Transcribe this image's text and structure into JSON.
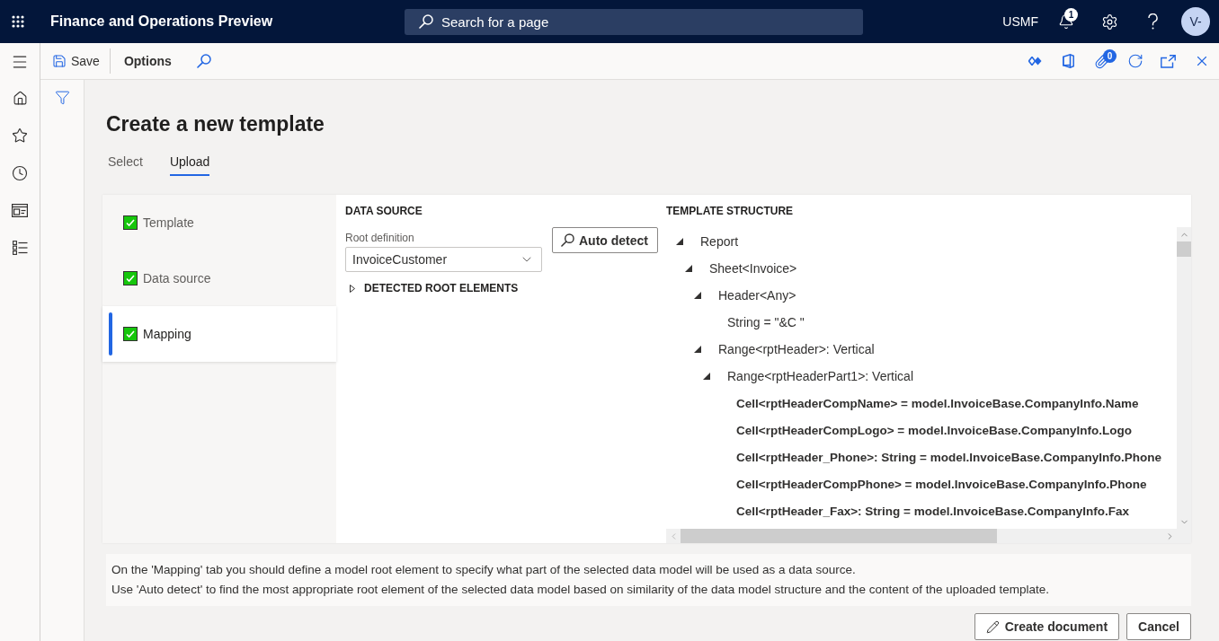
{
  "app_bar": {
    "title": "Finance and Operations Preview",
    "search": {
      "placeholder": "Search for a page"
    },
    "company": "USMF",
    "notifications": {
      "count": "1"
    },
    "avatar": {
      "initials": "V-"
    }
  },
  "action_bar": {
    "save": "Save",
    "options": "Options",
    "attachments": {
      "count": "0"
    }
  },
  "page": {
    "title": "Create a new template",
    "tabs": [
      {
        "label": "Select",
        "selected": false
      },
      {
        "label": "Upload",
        "selected": true
      }
    ]
  },
  "steps": [
    {
      "label": "Template",
      "checked": true,
      "selected": false
    },
    {
      "label": "Data source",
      "checked": true,
      "selected": false
    },
    {
      "label": "Mapping",
      "checked": true,
      "selected": true
    }
  ],
  "data_source": {
    "heading": "DATA SOURCE",
    "root_definition": {
      "label": "Root definition",
      "value": "InvoiceCustomer"
    },
    "auto_detect": "Auto detect",
    "detected_root_elements": {
      "label": "DETECTED ROOT ELEMENTS",
      "expanded": false
    }
  },
  "template_structure": {
    "heading": "TEMPLATE STRUCTURE",
    "tree": [
      {
        "label": "Report",
        "expanded": true,
        "bound": false,
        "children": [
          {
            "label": "Sheet<Invoice>",
            "expanded": true,
            "bound": false,
            "children": [
              {
                "label": "Header<Any>",
                "expanded": true,
                "bound": false,
                "children": [
                  {
                    "label": "String = \"&C \"",
                    "bound": false
                  }
                ]
              },
              {
                "label": "Range<rptHeader>: Vertical",
                "expanded": true,
                "bound": false,
                "children": [
                  {
                    "label": "Range<rptHeaderPart1>: Vertical",
                    "expanded": true,
                    "bound": false,
                    "children": [
                      {
                        "label": "Cell<rptHeaderCompName> = model.InvoiceBase.CompanyInfo.Name",
                        "bound": true
                      },
                      {
                        "label": "Cell<rptHeaderCompLogo> = model.InvoiceBase.CompanyInfo.Logo",
                        "bound": true
                      },
                      {
                        "label": "Cell<rptHeader_Phone>: String = model.InvoiceBase.CompanyInfo.Phone",
                        "bound": true
                      },
                      {
                        "label": "Cell<rptHeaderCompPhone> = model.InvoiceBase.CompanyInfo.Phone",
                        "bound": true
                      },
                      {
                        "label": "Cell<rptHeader_Fax>: String = model.InvoiceBase.CompanyInfo.Fax",
                        "bound": true
                      }
                    ]
                  }
                ]
              }
            ]
          }
        ]
      }
    ]
  },
  "info": [
    "On the 'Mapping' tab you should define a model root element to specify what part of the selected data model will be used as a data source.",
    "Use 'Auto detect' to find the most appropriate root element of the selected data model based on similarity of the data model structure and the content of the uploaded template."
  ],
  "buttons": [
    {
      "label": "Create document",
      "kind": "edit"
    },
    {
      "label": "Cancel",
      "kind": "plain"
    }
  ]
}
